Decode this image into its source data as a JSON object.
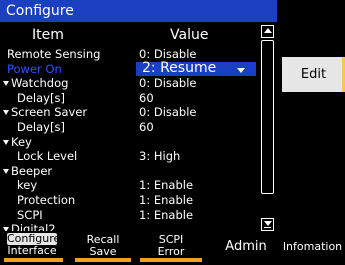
{
  "title": "Configure",
  "headers": {
    "item": "Item",
    "value": "Value"
  },
  "rows": [
    {
      "label": "Remote Sensing",
      "value": "0: Disable",
      "type": "top"
    },
    {
      "label": "Power On",
      "value": "2: Resume",
      "type": "top",
      "selected": true
    },
    {
      "label": "Watchdog",
      "value": "0: Disable",
      "type": "group"
    },
    {
      "label": "Delay[s]",
      "value": "60",
      "type": "sub"
    },
    {
      "label": "Screen Saver",
      "value": "0: Disable",
      "type": "group"
    },
    {
      "label": "Delay[s]",
      "value": "60",
      "type": "sub"
    },
    {
      "label": "Key",
      "value": "",
      "type": "group"
    },
    {
      "label": "Lock Level",
      "value": "3: High",
      "type": "sub"
    },
    {
      "label": "Beeper",
      "value": "",
      "type": "group"
    },
    {
      "label": "key",
      "value": "1: Enable",
      "type": "sub"
    },
    {
      "label": "Protection",
      "value": "1: Enable",
      "type": "sub"
    },
    {
      "label": "SCPI",
      "value": "1: Enable",
      "type": "sub"
    },
    {
      "label": "Digital2",
      "value": "",
      "type": "group"
    }
  ],
  "side": {
    "edit_label": "Edit"
  },
  "softkeys": [
    {
      "line1": "Configure",
      "line2": "Interface"
    },
    {
      "line1": "Recall",
      "line2": "Save"
    },
    {
      "line1": "SCPI",
      "line2": "Error"
    },
    {
      "line1": "Admin",
      "line2": ""
    },
    {
      "line1": "Infomation",
      "line2": ""
    }
  ],
  "colors": {
    "accent_blue": "#1a3fc0",
    "selected_text": "#2a55ff",
    "softkey_accent": "#f0a020"
  }
}
